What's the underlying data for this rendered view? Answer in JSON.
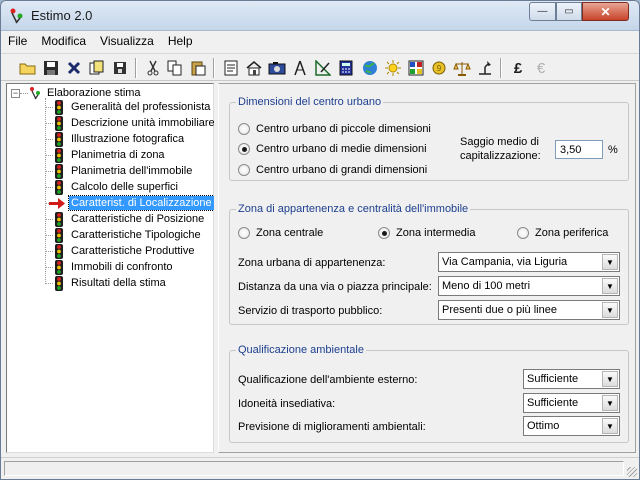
{
  "window": {
    "title": "Estimo 2.0",
    "minimize_glyph": "—",
    "maximize_glyph": "▭",
    "close_glyph": "✕"
  },
  "menu": [
    "File",
    "Modifica",
    "Visualizza",
    "Help"
  ],
  "toolbar": {
    "icons": [
      "open-folder-icon",
      "save-icon",
      "delete-icon",
      "copy-doc-icon",
      "save-as-icon",
      "cut-icon",
      "copy-icon",
      "paste-icon",
      "report-icon",
      "house-icon",
      "camera-icon",
      "compass-icon",
      "drafting-icon",
      "calculator-icon",
      "globe-icon",
      "sun-icon",
      "building-grid-icon",
      "coins-icon",
      "scales-icon",
      "lamp-icon",
      "pound-icon",
      "euro-icon"
    ],
    "pound_glyph": "£",
    "euro_glyph": "€"
  },
  "tree": {
    "root_label": "Elaborazione stima",
    "items": [
      "Generalità del professionista",
      "Descrizione unità immobiliare",
      "Illustrazione fotografica",
      "Planimetria di zona",
      "Planimetria dell'immobile",
      "Calcolo delle superfici",
      "Caratterist. di Localizzazione",
      "Caratteristiche di Posizione",
      "Caratteristiche Tipologiche",
      "Caratteristiche Produttive",
      "Immobili di confronto",
      "Risultati della stima"
    ],
    "selected_index": 6
  },
  "urbano": {
    "legend": "Dimensioni del centro urbano",
    "options": [
      "Centro urbano di piccole dimensioni",
      "Centro urbano di medie dimensioni",
      "Centro urbano di grandi dimensioni"
    ],
    "selected_index": 1,
    "saggio_label_1": "Saggio medio di",
    "saggio_label_2": "capitalizzazione:",
    "saggio_value": "3,50",
    "saggio_unit": "%"
  },
  "zona": {
    "legend": "Zona di appartenenza e centralità dell'immobile",
    "options": [
      "Zona centrale",
      "Zona intermedia",
      "Zona periferica"
    ],
    "selected_index": 1,
    "fields": [
      {
        "label": "Zona urbana di appartenenza:",
        "value": "Via Campania, via Liguria"
      },
      {
        "label": "Distanza da una via o piazza principale:",
        "value": "Meno di 100 metri"
      },
      {
        "label": "Servizio di trasporto pubblico:",
        "value": "Presenti due o più linee"
      }
    ]
  },
  "ambiente": {
    "legend": "Qualificazione ambientale",
    "fields": [
      {
        "label": "Qualificazione dell'ambiente esterno:",
        "value": "Sufficiente"
      },
      {
        "label": "Idoneità insediativa:",
        "value": "Sufficiente"
      },
      {
        "label": "Previsione di miglioramenti ambientali:",
        "value": "Ottimo"
      }
    ]
  },
  "colors": {
    "selection": "#3399ff",
    "legend_text": "#1d3f8f",
    "traffic_red": "#e02020",
    "traffic_yellow": "#f2c200",
    "traffic_green": "#1fa32a",
    "arrow_red": "#d11a1a"
  }
}
